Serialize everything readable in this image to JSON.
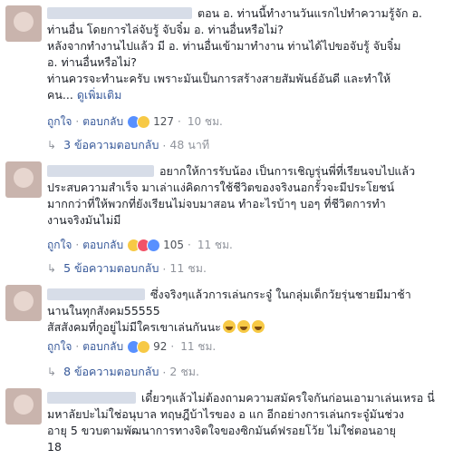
{
  "comments": [
    {
      "name_hidden": true,
      "lines": [
        "ตอน อ. ท่านนี้ทำงานวันแรกไปทำความรู้จัก อ.",
        "ท่านอื่น โดยการไล่จับรู้ จับจิ๋ม อ. ท่านอื่นหรือไม่?",
        "หลังจากทำงานไปแล้ว มี อ. ท่านอื่นเข้ามาทำงาน ท่านได้ไปขอจับรู้ จับจิ๋ม",
        "อ. ท่านอื่นหรือไม่?",
        "ท่านควรจะทำนะครับ เพราะมันเป็นการสร้างสายสัมพันธ์อันดี และทำให้",
        "คน..."
      ],
      "see_more": "ดูเพิ่มเติม",
      "like": "ถูกใจ",
      "reply": "ตอบกลับ",
      "reaction_count": "127",
      "time": "10 ชม.",
      "replies_label": "3 ข้อความตอบกลับ",
      "replies_time": "48 นาที"
    },
    {
      "name_hidden": true,
      "lines": [
        "อยากให้การรับน้อง เป็นการเชิญรุ่นพี่ที่เรียนจบไปแล้ว",
        "ประสบความสำเร็จ มาเล่าแง่คิดการใช้ชีวิตของจริงนอกรั้วจะมีประโยชน์",
        "มากกว่าที่ให้พวกที่ยังเรียนไม่จบมาสอน ทำอะไรบ้าๆ บอๆ ที่ชีวิตการทำ",
        "งานจริงมันไม่มี"
      ],
      "like": "ถูกใจ",
      "reply": "ตอบกลับ",
      "reaction_count": "105",
      "time": "11 ชม.",
      "replies_label": "5 ข้อความตอบกลับ",
      "replies_time": "11 ชม."
    },
    {
      "name_hidden": true,
      "lines": [
        "ซึ่งจริงๆแล้วการเล่นกระจู๋ ในกลุ่มเด็กวัยรุ่นชายมีมาช้า",
        "นานในทุกสังคม55555",
        "สัสสังคมที่กูอยู่ไม่มีใครเขาเล่นกันนะ"
      ],
      "like": "ถูกใจ",
      "reply": "ตอบกลับ",
      "reaction_count": "92",
      "time": "11 ชม.",
      "replies_label": "8 ข้อความตอบกลับ",
      "replies_time": "2 ชม."
    },
    {
      "name_hidden": true,
      "lines": [
        "เดี๋ยวๆแล้วไม่ต้องถามความสมัครใจกันก่อนเอามาเล่นเหรอ นี่",
        "มหาลัยปะไม่ใช่อนุบาล ทฤษฎีบ้าไรของ อ แก อีกอย่างการเล่นกระจู๋มันช่วง",
        "อายุ 5 ขวบตามพัฒนาการทางจิตใจของซิกมันด์ฟรอยโว้ย ไม่ใช่ตอนอายุ",
        "18"
      ]
    }
  ],
  "colors": {
    "link": "#365899",
    "meta": "#90949c",
    "text": "#1d2129",
    "like_blue": "#5890ff"
  }
}
